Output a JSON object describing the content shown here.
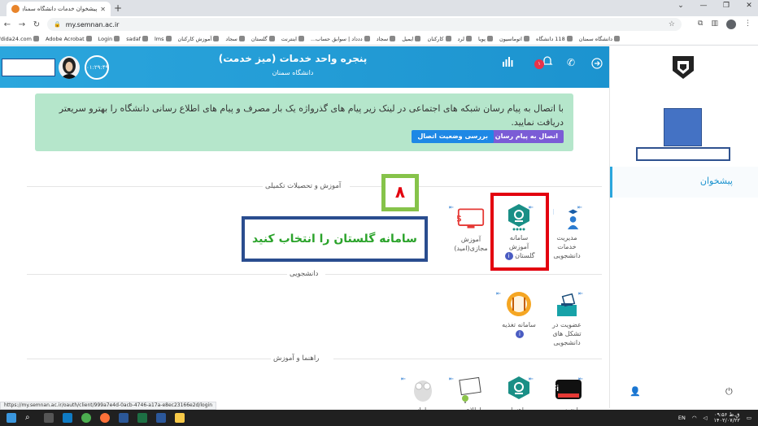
{
  "browser": {
    "tab_title": "پیشخوان خدمات دانشگاه سمنان",
    "url": "my.semnan.ac.ir",
    "bookmarks": [
      "دانشگاه سمنان",
      "118 دانشگاه",
      "اتوماسیون",
      "پویا",
      "لرد",
      "کارکنان",
      "ایمیل",
      "سجاد",
      "ددداد | سوابق حساب...",
      "اینترنت",
      "گلستان",
      "سجاد",
      "آموزش کارکنان",
      "lms",
      "sadaf",
      "Login",
      "Adobe Acrobat",
      "https://dida24.com/"
    ]
  },
  "header": {
    "title": "پنجره واحد خدمات (میز خدمت)",
    "subtitle": "دانشگاه سمنان",
    "notification_count": "۱",
    "timer": "۰۱:۲۹:۴۹"
  },
  "notice": {
    "text": "با اتصال به پیام رسان شبکه های اجتماعی در لینک زیر پیام های گذرواژه یک بار مصرف و پیام های اطلاع رسانی دانشگاه را بهترو سریعتر دریافت نمایید.",
    "connect_button": "اتصال به پیام رسان",
    "status_button": "بررسی وضعیت اتصال",
    "colors": {
      "background": "#b5e6cb",
      "connect": "#7b5cd6",
      "status": "#1e88e5"
    }
  },
  "sections": {
    "education": {
      "title": "آموزش و تحصیلات تکمیلی",
      "services": [
        {
          "label": "مدیریت خدمات دانشجویی",
          "icon": "srm-icon"
        },
        {
          "label": "آموزش گلستان",
          "icon": "golestan-icon"
        },
        {
          "label": "آموزش مجازی(امید)",
          "icon": "lms-icon"
        }
      ]
    },
    "student": {
      "title": "دانشجویی",
      "services": [
        {
          "label": "عضویت در تشکل های دانشجویی",
          "icon": "ballot-box-icon"
        },
        {
          "label": "سامانه تغذیه",
          "icon": "food-icon"
        }
      ]
    },
    "guide": {
      "title": "راهنما و آموزش",
      "services": [
        {
          "label": "اینترنت",
          "icon": "wifi-hotspot-icon"
        },
        {
          "label": "راهنما",
          "icon": "golestan-icon"
        },
        {
          "label": "اطلاعیه",
          "icon": "notice-icon"
        },
        {
          "label": "سامانه",
          "icon": "owl-icon"
        }
      ]
    }
  },
  "annotations": {
    "step": "۸",
    "instruction": "سامانه گلستان را انتخاب کنید"
  },
  "sidebar": {
    "dashboard_label": "پیشخوان"
  },
  "status_url": "https://my.semnan.ac.ir/oauth/client/999a7e4d-0acb-4746-a17a-e8ec23166e2d/login",
  "taskbar": {
    "lang": "EN",
    "time": "۰۹:۵۶ ق.ظ",
    "date": "۱۴۰۲/۰۷/۲۲"
  }
}
